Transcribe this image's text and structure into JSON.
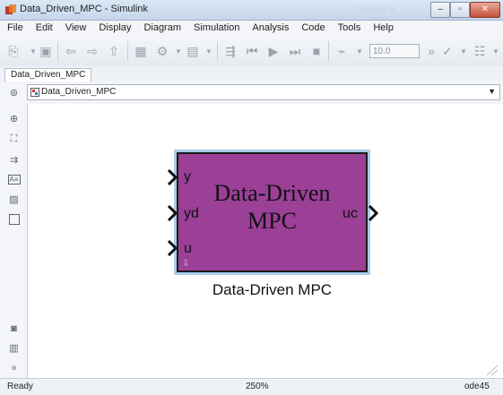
{
  "window": {
    "title": "Data_Driven_MPC - Simulink",
    "ghost_text": "Organize ▾"
  },
  "menu": [
    "File",
    "Edit",
    "View",
    "Display",
    "Diagram",
    "Simulation",
    "Analysis",
    "Code",
    "Tools",
    "Help"
  ],
  "toolbar": {
    "stop_time": "10.0"
  },
  "tabs": [
    {
      "label": "Data_Driven_MPC"
    }
  ],
  "breadcrumb": {
    "model": "Data_Driven_MPC"
  },
  "block": {
    "title_line1": "Data-Driven",
    "title_line2": "MPC",
    "inputs": [
      "y",
      "yd",
      "u"
    ],
    "output": "uc",
    "label": "Data-Driven MPC",
    "fill_color": "#9b3f97"
  },
  "status": {
    "state": "Ready",
    "zoom": "250%",
    "solver": "ode45"
  },
  "colors": {
    "accent": "#a9cce8"
  }
}
